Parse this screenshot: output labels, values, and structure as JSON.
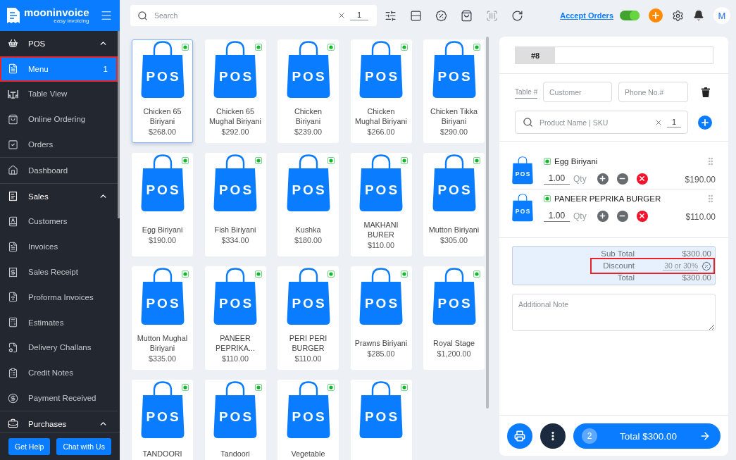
{
  "sidebar": {
    "brand": {
      "name": "mooninvoice",
      "tagline": "easy invoicing"
    },
    "items": [
      {
        "label": "POS",
        "expanded": true,
        "selected": false,
        "highlighted": false,
        "children": [
          {
            "label": "Menu",
            "badge": "1",
            "selected": true,
            "highlighted": true
          },
          {
            "label": "Table View",
            "selected": false,
            "highlighted": false
          },
          {
            "label": "Online Ordering",
            "selected": false,
            "highlighted": false
          },
          {
            "label": "Orders",
            "selected": false,
            "highlighted": false
          }
        ]
      },
      {
        "label": "Dashboard",
        "selected": false,
        "highlighted": false
      },
      {
        "label": "Sales",
        "expanded": true,
        "selected": false,
        "highlighted": false,
        "children": [
          {
            "label": "Customers",
            "selected": false,
            "highlighted": false
          },
          {
            "label": "Invoices",
            "selected": false,
            "highlighted": false
          },
          {
            "label": "Sales Receipt",
            "selected": false,
            "highlighted": false
          },
          {
            "label": "Proforma Invoices",
            "selected": false,
            "highlighted": false
          },
          {
            "label": "Estimates",
            "selected": false,
            "highlighted": false
          },
          {
            "label": "Delivery Challans",
            "selected": false,
            "highlighted": false
          },
          {
            "label": "Credit Notes",
            "selected": false,
            "highlighted": false
          },
          {
            "label": "Payment Received",
            "selected": false,
            "highlighted": false
          }
        ]
      },
      {
        "label": "Purchases",
        "expanded": true,
        "selected": false,
        "highlighted": false
      }
    ],
    "buttons": [
      {
        "label": "Get Help"
      },
      {
        "label": "Chat with Us"
      }
    ]
  },
  "toolbar": {
    "search": {
      "placeholder": "Search",
      "quantity": "1"
    },
    "accept_orders": {
      "label": "Accept Orders",
      "on": true
    },
    "avatar": "M"
  },
  "products": [
    {
      "name": "Chicken 65 Biriyani",
      "price": "$268.00",
      "image_text": "POS",
      "selected": true
    },
    {
      "name": "Chicken 65 Mughal Biriyani",
      "price": "$292.00",
      "image_text": "POS",
      "selected": false
    },
    {
      "name": "Chicken Biriyani",
      "price": "$239.00",
      "image_text": "POS",
      "selected": false
    },
    {
      "name": "Chicken Mughal Biriyani",
      "price": "$266.00",
      "image_text": "POS",
      "selected": false
    },
    {
      "name": "Chicken Tikka Biriyani",
      "price": "$290.00",
      "image_text": "POS",
      "selected": false
    },
    {
      "name": "Egg Biriyani",
      "price": "$190.00",
      "image_text": "POS",
      "selected": false
    },
    {
      "name": "Fish Biriyani",
      "price": "$334.00",
      "image_text": "POS",
      "selected": false
    },
    {
      "name": "Kushka",
      "price": "$180.00",
      "image_text": "POS",
      "selected": false
    },
    {
      "name": "MAKHANI BURER",
      "price": "$110.00",
      "image_text": "POS",
      "selected": false
    },
    {
      "name": "Mutton Biriyani",
      "price": "$305.00",
      "image_text": "POS",
      "selected": false
    },
    {
      "name": "Mutton Mughal Biriyani",
      "price": "$335.00",
      "image_text": "POS",
      "selected": false
    },
    {
      "name": "PANEER PEPRIKA...",
      "price": "$110.00",
      "image_text": "POS",
      "selected": false
    },
    {
      "name": "PERI PERI BURGER",
      "price": "$110.00",
      "image_text": "POS",
      "selected": false
    },
    {
      "name": "Prawns Biriyani",
      "price": "$285.00",
      "image_text": "POS",
      "selected": false
    },
    {
      "name": "Royal Stage",
      "price": "$1,200.00",
      "image_text": "POS",
      "selected": false
    },
    {
      "name": "TANDOORI",
      "image_text": "POS",
      "selected": false
    },
    {
      "name": "Tandoori",
      "image_text": "POS",
      "selected": false
    },
    {
      "name": "Vegetable",
      "image_text": "POS",
      "selected": false
    },
    {
      "image_text": "POS",
      "selected": false
    }
  ],
  "order": {
    "tabs": [
      {
        "label": "#8",
        "selected": true
      }
    ],
    "table_field": {
      "placeholder": "Table #"
    },
    "customer_field": {
      "placeholder": "Customer"
    },
    "phone_field": {
      "placeholder": "Phone No.#"
    },
    "product_search": {
      "placeholder": "Product Name | SKU",
      "quantity": "1"
    },
    "items": [
      {
        "name": "Egg Biriyani",
        "image_text": "POS",
        "quantity": "1.00",
        "quantity_label": "Qty",
        "price": "$190.00"
      },
      {
        "name": "PANEER PEPRIKA BURGER",
        "image_text": "POS",
        "quantity": "1.00",
        "quantity_label": "Qty",
        "price": "$110.00"
      }
    ],
    "totals": [
      {
        "kind": "amount",
        "label": "Sub Total",
        "value": "$300.00",
        "highlighted": false
      },
      {
        "kind": "input",
        "label": "Discount",
        "placeholder": "30 or 30%",
        "highlighted": true
      },
      {
        "kind": "amount",
        "label": "Total",
        "value": "$300.00",
        "highlighted": false
      }
    ],
    "note": {
      "placeholder": "Additional Note"
    },
    "checkout": {
      "count": "2",
      "label": "Total $300.00"
    }
  }
}
